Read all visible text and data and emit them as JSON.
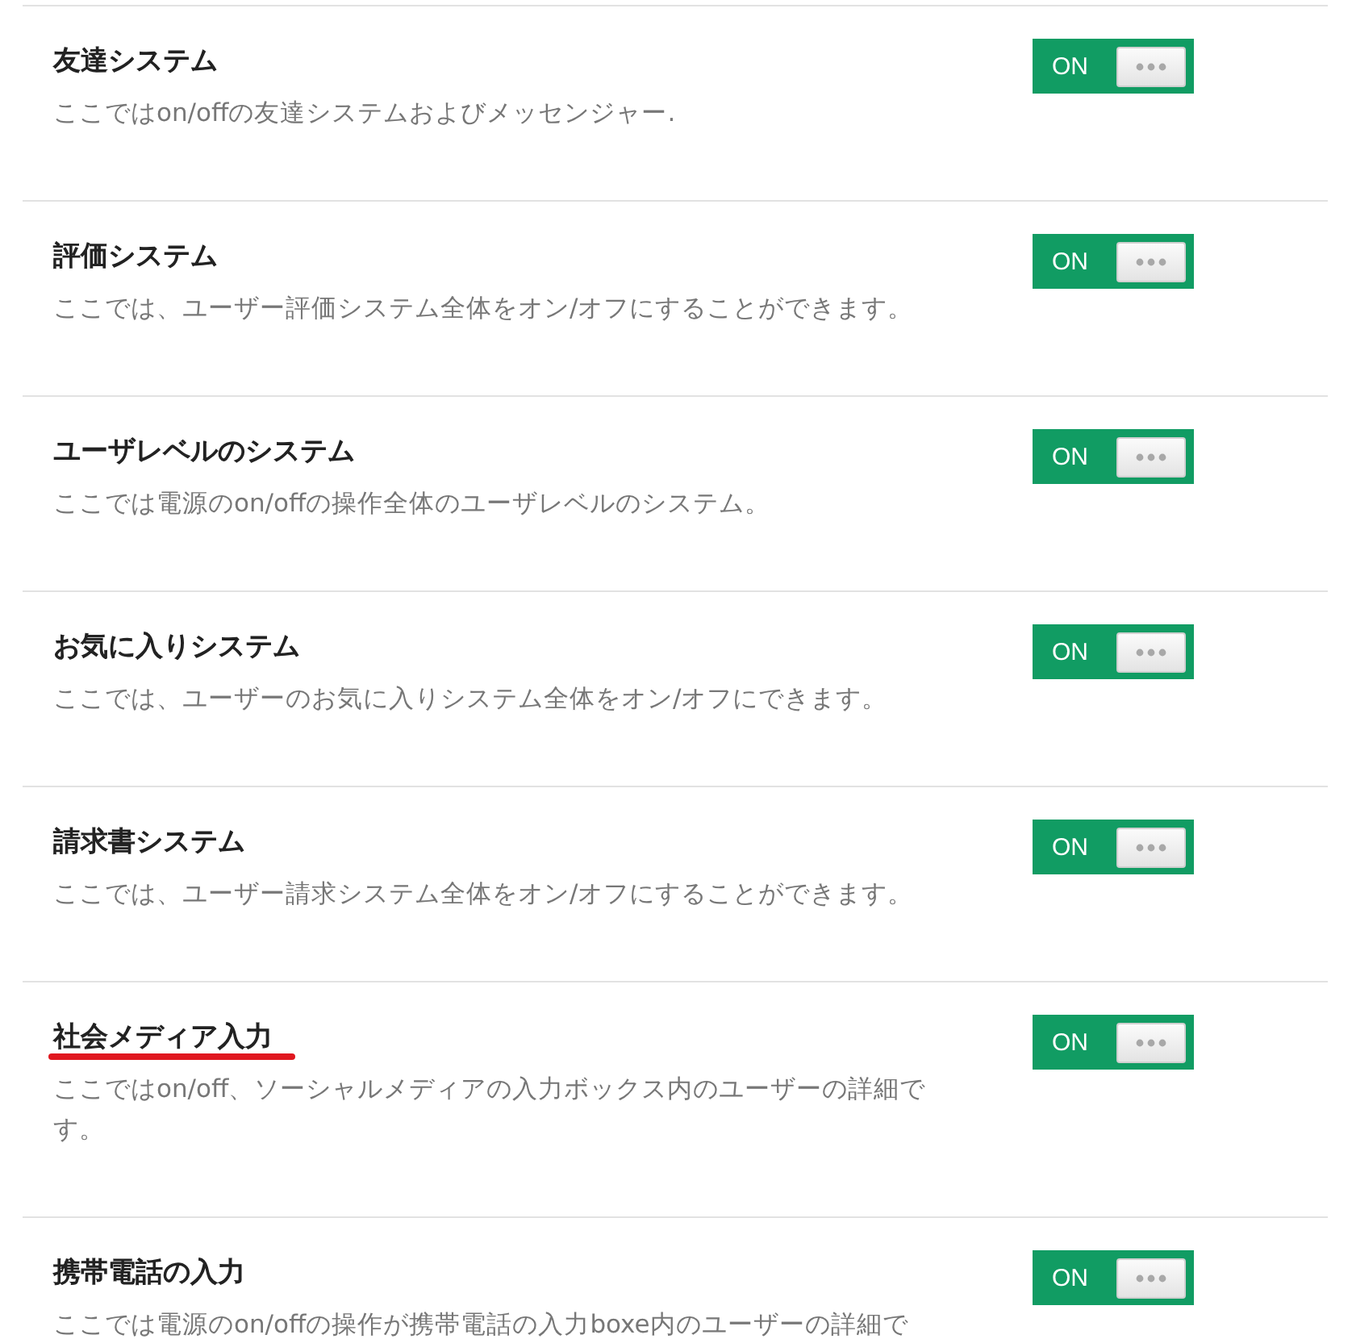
{
  "settings": [
    {
      "title": "友達システム",
      "description": "ここではon/offの友達システムおよびメッセンジャー.",
      "underlined": false,
      "toggle": {
        "label": "ON",
        "on": true
      }
    },
    {
      "title": "評価システム",
      "description": "ここでは、ユーザー評価システム全体をオン/オフにすることができます。",
      "underlined": false,
      "toggle": {
        "label": "ON",
        "on": true
      }
    },
    {
      "title": "ユーザレベルのシステム",
      "description": "ここでは電源のon/offの操作全体のユーザレベルのシステム。",
      "underlined": false,
      "toggle": {
        "label": "ON",
        "on": true
      }
    },
    {
      "title": "お気に入りシステム",
      "description": "ここでは、ユーザーのお気に入りシステム全体をオン/オフにできます。",
      "underlined": false,
      "toggle": {
        "label": "ON",
        "on": true
      }
    },
    {
      "title": "請求書システム",
      "description": "ここでは、ユーザー請求システム全体をオン/オフにすることができます。",
      "underlined": false,
      "toggle": {
        "label": "ON",
        "on": true
      }
    },
    {
      "title": "社会メディア入力",
      "description": "ここではon/off、ソーシャルメディアの入力ボックス内のユーザーの詳細です。",
      "underlined": true,
      "toggle": {
        "label": "ON",
        "on": true
      }
    },
    {
      "title": "携帯電話の入力",
      "description": "ここでは電源のon/offの操作が携帯電話の入力boxe内のユーザーの詳細で",
      "underlined": false,
      "toggle": {
        "label": "ON",
        "on": true
      }
    }
  ]
}
